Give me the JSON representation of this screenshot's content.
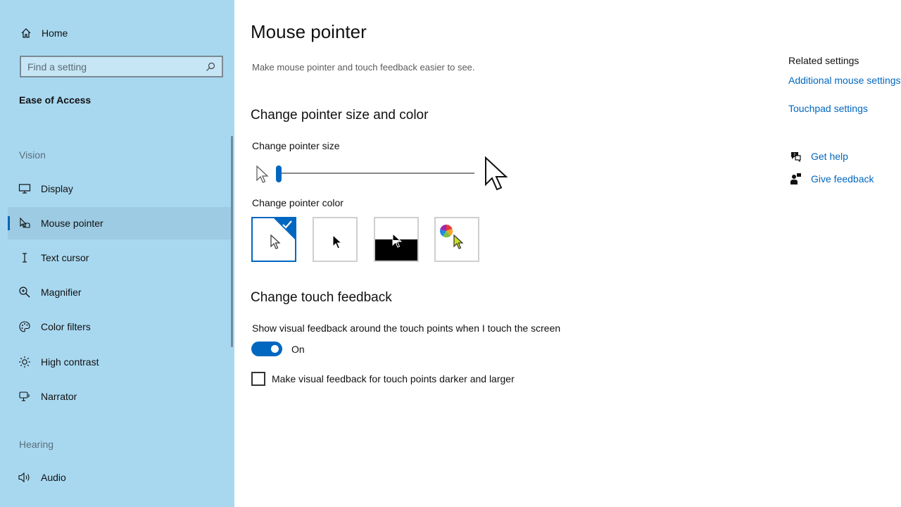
{
  "sidebar": {
    "home_label": "Home",
    "search_placeholder": "Find a setting",
    "section_title": "Ease of Access",
    "group_vision": "Vision",
    "group_hearing": "Hearing",
    "items": [
      {
        "label": "Display",
        "icon": "monitor-icon"
      },
      {
        "label": "Mouse pointer",
        "icon": "mouse-pointer-icon",
        "selected": true
      },
      {
        "label": "Text cursor",
        "icon": "text-cursor-icon"
      },
      {
        "label": "Magnifier",
        "icon": "magnifier-icon"
      },
      {
        "label": "Color filters",
        "icon": "color-filters-icon"
      },
      {
        "label": "High contrast",
        "icon": "high-contrast-icon"
      },
      {
        "label": "Narrator",
        "icon": "narrator-icon"
      },
      {
        "label": "Audio",
        "icon": "speaker-icon"
      }
    ]
  },
  "main": {
    "title": "Mouse pointer",
    "description": "Make mouse pointer and touch feedback easier to see.",
    "size_color_heading": "Change pointer size and color",
    "pointer_size_label": "Change pointer size",
    "pointer_size_value": 1,
    "pointer_size_min": 1,
    "pointer_size_max": 15,
    "pointer_color_label": "Change pointer color",
    "pointer_color_options": [
      "white",
      "black",
      "inverted",
      "custom"
    ],
    "pointer_color_selected": "white",
    "touch_heading": "Change touch feedback",
    "touch_feedback_label": "Show visual feedback around the touch points when I touch the screen",
    "touch_toggle_state": "On",
    "touch_darker_label": "Make visual feedback for touch points darker and larger",
    "touch_darker_checked": false
  },
  "related": {
    "title": "Related settings",
    "additional_mouse": "Additional mouse settings",
    "touchpad": "Touchpad settings",
    "get_help": "Get help",
    "give_feedback": "Give feedback"
  },
  "colors": {
    "sidebar_bg": "#a8d8f0",
    "accent": "#0067c0",
    "custom_pointer": "#c8e01e"
  }
}
